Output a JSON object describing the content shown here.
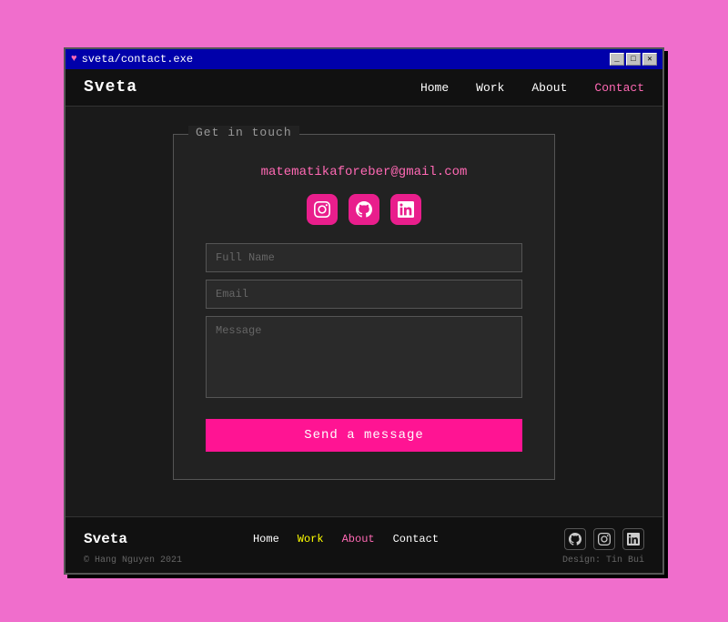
{
  "window": {
    "title": "sveta/contact.exe",
    "controls": [
      "_",
      "□",
      "✕"
    ]
  },
  "navbar": {
    "brand": "Sveta",
    "links": [
      {
        "label": "Home",
        "active": false
      },
      {
        "label": "Work",
        "active": false
      },
      {
        "label": "About",
        "active": false
      },
      {
        "label": "Contact",
        "active": true
      }
    ]
  },
  "contact": {
    "legend": "Get in touch",
    "email": "matematikaforeber@gmail.com",
    "social": [
      {
        "name": "instagram",
        "label": "♡"
      },
      {
        "name": "github",
        "label": "⊙"
      },
      {
        "name": "linkedin",
        "label": "in"
      }
    ],
    "form": {
      "name_placeholder": "Full Name",
      "email_placeholder": "Email",
      "message_placeholder": "Message",
      "submit_label": "Send a message"
    }
  },
  "footer": {
    "brand": "Sveta",
    "links": [
      {
        "label": "Home",
        "style": "white"
      },
      {
        "label": "Work",
        "style": "yellow"
      },
      {
        "label": "About",
        "style": "active"
      },
      {
        "label": "Contact",
        "style": "white"
      }
    ],
    "copyright": "© Hang Nguyen 2021",
    "design_credit": "Design: Tin Bui"
  }
}
